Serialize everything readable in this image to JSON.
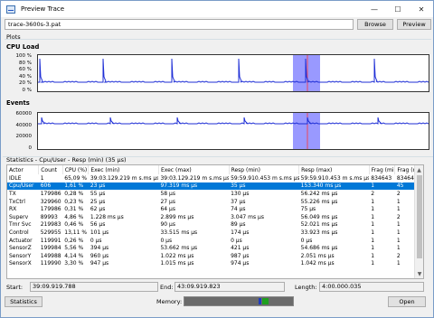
{
  "window": {
    "title": "Preview Trace",
    "minimize": "—",
    "maximize": "☐",
    "close": "✕"
  },
  "path": {
    "value": "trace-3600s-3.pat",
    "browse": "Browse",
    "preview": "Preview"
  },
  "plots": {
    "group_label": "Plots",
    "cpu": {
      "title": "CPU Load",
      "yticks": [
        "100 %",
        "80 %",
        "60 %",
        "40 %",
        "20 %",
        "0 %"
      ]
    },
    "events": {
      "title": "Events",
      "yticks": [
        "60000",
        "40000",
        "20000",
        "0"
      ]
    }
  },
  "stats": {
    "group_label": "Statistics - Cpu/User - Resp (min) (35 µs)",
    "columns": [
      "Actor",
      "Count",
      "CPU (%)",
      "Exec (min)",
      "Exec (max)",
      "Resp (min)",
      "Resp (max)",
      "Frag (min)",
      "Frag (max)"
    ],
    "rows": [
      [
        "IDLE",
        "1",
        "65,09 %",
        "39:03.129.219 m s.ms µs",
        "39:03.129.219 m s.ms µs",
        "59:59.910.453 m s.ms µs",
        "59:59.910.453 m s.ms µs",
        "834643",
        "834643"
      ],
      [
        "Cpu/User",
        "606",
        "1,61 %",
        "23 µs",
        "97.319 ms µs",
        "35 µs",
        "153.340 ms µs",
        "1",
        "45"
      ],
      [
        "TX",
        "179986",
        "0,28 %",
        "55 µs",
        "58 µs",
        "130 µs",
        "56.242 ms µs",
        "2",
        "2"
      ],
      [
        "TxCtrl",
        "329960",
        "0,23 %",
        "25 µs",
        "27 µs",
        "37 µs",
        "55.226 ms µs",
        "1",
        "1"
      ],
      [
        "RX",
        "179986",
        "0,31 %",
        "62 µs",
        "64 µs",
        "74 µs",
        "75 µs",
        "1",
        "1"
      ],
      [
        "Superv",
        "89993",
        "4,86 %",
        "1.228 ms µs",
        "2.899 ms µs",
        "3.047 ms µs",
        "56.049 ms µs",
        "1",
        "2"
      ],
      [
        "Tmr Svc",
        "219983",
        "0,46 %",
        "56 µs",
        "90 µs",
        "89 µs",
        "52.021 ms µs",
        "1",
        "1"
      ],
      [
        "Control",
        "529955",
        "13,11 %",
        "101 µs",
        "33.515 ms µs",
        "174 µs",
        "33.923 ms µs",
        "1",
        "1"
      ],
      [
        "Actuator",
        "119991",
        "0,26 %",
        "0 µs",
        "0 µs",
        "0 µs",
        "0 µs",
        "1",
        "1"
      ],
      [
        "SensorZ",
        "199984",
        "5,56 %",
        "394 µs",
        "53.662 ms µs",
        "421 µs",
        "54.686 ms µs",
        "1",
        "1"
      ],
      [
        "SensorY",
        "149988",
        "4,14 %",
        "960 µs",
        "1.022 ms µs",
        "987 µs",
        "2.051 ms µs",
        "1",
        "2"
      ],
      [
        "SensorX",
        "119990",
        "3,30 %",
        "947 µs",
        "1.015 ms µs",
        "974 µs",
        "1.042 ms µs",
        "1",
        "1"
      ]
    ]
  },
  "footer": {
    "start_label": "Start:",
    "start_value": "39:09.919.788",
    "end_label": "End:",
    "end_value": "43:09.919.823",
    "length_label": "Length:",
    "length_value": "4:00.000.035",
    "statistics_button": "Statistics",
    "memory_label": "Memory:",
    "open_button": "Open"
  },
  "colors": {
    "accent": "#0078d7",
    "plot_line": "#1f2fd6",
    "highlight": "#9999ff",
    "cursor": "#ff3333"
  }
}
